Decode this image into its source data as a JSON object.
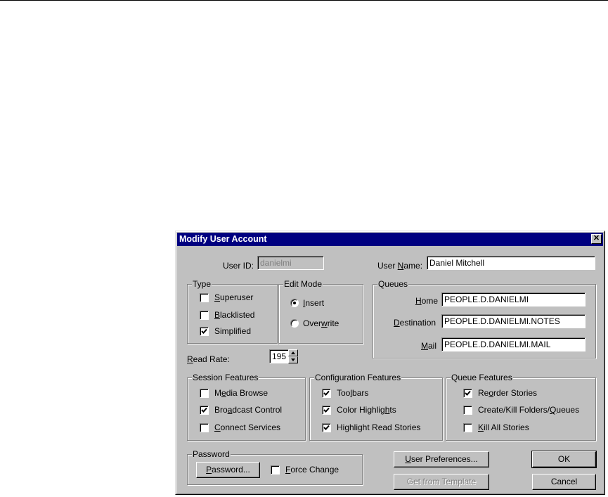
{
  "dialog": {
    "title": "Modify User Account",
    "close_glyph": "✕"
  },
  "user": {
    "id_label": "User ID:",
    "id_value": "danielmi",
    "name_label_pre": "User ",
    "name_label_ul": "N",
    "name_label_post": "ame:",
    "name_value": "Daniel Mitchell"
  },
  "type_group": {
    "title": "Type",
    "items": [
      {
        "ul": "S",
        "rest": "uperuser",
        "checked": false
      },
      {
        "ul": "B",
        "rest": "lacklisted",
        "checked": false
      },
      {
        "ul": "",
        "rest": "Simplified",
        "checked": true
      }
    ]
  },
  "edit_mode": {
    "title": "Edit Mode",
    "insert_ul": "I",
    "insert_rest": "nsert",
    "overwrite_pre": "Over",
    "overwrite_ul": "w",
    "overwrite_post": "rite",
    "selected": "Insert"
  },
  "queues": {
    "title": "Queues",
    "home_ul": "H",
    "home_rest": "ome",
    "home_value": "PEOPLE.D.DANIELMI",
    "dest_ul": "D",
    "dest_rest": "estination",
    "dest_value": "PEOPLE.D.DANIELMI.NOTES",
    "mail_ul": "M",
    "mail_rest": "ail",
    "mail_value": "PEOPLE.D.DANIELMI.MAIL"
  },
  "read_rate": {
    "label_ul": "R",
    "label_rest": "ead Rate:",
    "value": "195"
  },
  "session_features": {
    "title": "Session Features",
    "items": [
      {
        "pre": "M",
        "ul": "e",
        "post": "dia Browse",
        "checked": false
      },
      {
        "pre": "Bro",
        "ul": "a",
        "post": "dcast Control",
        "checked": true
      },
      {
        "pre": "",
        "ul": "C",
        "post": "onnect Services",
        "checked": false
      }
    ]
  },
  "configuration_features": {
    "title": "Configuration Features",
    "items": [
      {
        "pre": "Too",
        "ul": "l",
        "post": "bars",
        "checked": true
      },
      {
        "pre": "Color Highlig",
        "ul": "h",
        "post": "ts",
        "checked": true
      },
      {
        "pre": "Highlight Read Stories",
        "ul": "",
        "post": "",
        "checked": true
      }
    ]
  },
  "queue_features": {
    "title": "Queue Features",
    "items": [
      {
        "pre": "Re",
        "ul": "o",
        "post": "rder Stories",
        "checked": true
      },
      {
        "pre": "Create/Kill Folders/",
        "ul": "Q",
        "post": "ueues",
        "checked": false
      },
      {
        "pre": "",
        "ul": "K",
        "post": "ill All Stories",
        "checked": false
      }
    ]
  },
  "password": {
    "title": "Password",
    "button_ul": "P",
    "button_rest": "assword...",
    "force_ul": "F",
    "force_rest": "orce Change",
    "force_checked": false
  },
  "buttons": {
    "user_prefs_ul": "U",
    "user_prefs_rest": "ser Preferences...",
    "template": "Get from Template",
    "ok": "OK",
    "cancel": "Cancel"
  }
}
